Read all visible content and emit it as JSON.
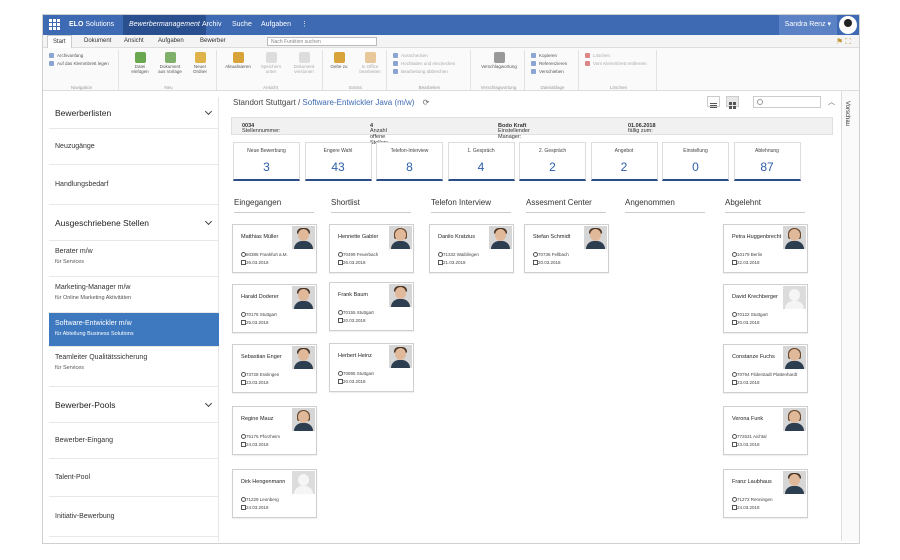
{
  "topbar": {
    "brand": "ELO",
    "brand_suffix": "Solutions",
    "tabs": [
      "Bewerbermanagement",
      "Archiv",
      "Suche",
      "Aufgaben",
      "⋮"
    ],
    "user": "Sandra Renz ▾"
  },
  "ribbon_tabs": [
    "Start",
    "Dokument",
    "Ansicht",
    "Aufgaben",
    "Bewerber"
  ],
  "ribbon_search_placeholder": "Nach Funktion suchen",
  "ribbon": {
    "navigation": {
      "items": [
        "Archivanfang",
        "Auf das Klemmbrett legen"
      ],
      "name": "Navigation"
    },
    "neu": {
      "buttons": [
        "Datei einfügen",
        "Dokument aus Vorlage",
        "Neuer Ordner"
      ],
      "name": "Neu"
    },
    "ansicht": {
      "buttons": [
        "Aktualisieren",
        "Speichern unter",
        "Dokument versionen"
      ],
      "name": "Ansicht"
    },
    "extras": {
      "buttons": [
        "Gehe zu",
        "In Office bearbeiten"
      ],
      "name": "Extras"
    },
    "bearbeiten": {
      "items": [
        "Ausschecken",
        "Hochladen und einchecken",
        "Bearbeitung abbrechen"
      ],
      "name": "Bearbeiten"
    },
    "verschlagwortung": {
      "button": "Verschlagwortung",
      "name": "Verschlagwortung"
    },
    "dateiablage": {
      "items": [
        "Kopieren",
        "Referenzieren",
        "Verschieben"
      ],
      "name": "Dateiablage"
    },
    "loeschen": {
      "items": [
        "Löschen",
        "Vom Klemmbrett entfernen"
      ],
      "name": "Löschen"
    }
  },
  "sidebar": [
    {
      "label": "Bewerberlisten",
      "head": true,
      "chev": true
    },
    {
      "label": "Neuzugänge"
    },
    {
      "label": "Handlungsbedarf"
    },
    {
      "label": "Ausgeschriebene Stellen",
      "head": true,
      "chev": true
    },
    {
      "label": "Berater m/w",
      "sub": "für Services"
    },
    {
      "label": "Marketing-Manager m/w",
      "sub": "für Online Marketing Aktivitäten"
    },
    {
      "label": "Software-Entwickler m/w",
      "sub": "für Abteilung Business Solutions",
      "active": true
    },
    {
      "label": "Teamleiter Qualitätssicherung",
      "sub": "für Services"
    },
    {
      "label": "Bewerber-Pools",
      "head": true,
      "chev": true
    },
    {
      "label": "Bewerber-Eingang"
    },
    {
      "label": "Talent-Pool"
    },
    {
      "label": "Initiativ-Bewerbung"
    }
  ],
  "breadcrumb": {
    "location": "Standort Stuttgart",
    "sep": "/",
    "job": "Software-Entwickler Java (m/w)",
    "refresh": "⟳"
  },
  "info": {
    "stellennummer_label": "Stellennummer:",
    "stellennummer": "0034",
    "offene_label": "Anzahl offene Stellen:",
    "offene": "4",
    "manager_label": "Einstellender Manager:",
    "manager": "Bodo Kraft",
    "faellig_label": "fällig zum:",
    "faellig": "01.06.2018"
  },
  "stats": [
    {
      "label": "Neue Bewerbung",
      "value": "3"
    },
    {
      "label": "Engere Wahl",
      "value": "43"
    },
    {
      "label": "Telefon-Interview",
      "value": "8"
    },
    {
      "label": "1. Gespräch",
      "value": "4"
    },
    {
      "label": "2. Gespräch",
      "value": "2"
    },
    {
      "label": "Angebot",
      "value": "2"
    },
    {
      "label": "Einstellung",
      "value": "0"
    },
    {
      "label": "Ablehnung",
      "value": "87"
    }
  ],
  "columns": [
    {
      "title": "Eingegangen",
      "cards": [
        {
          "name": "Matthias Müller",
          "loc": "60386 Frankfurt a.M.",
          "date": "26.03.2018",
          "photo": "m"
        },
        {
          "name": "Harald Doderer",
          "loc": "70178 Stuttgart",
          "date": "25.03.2018",
          "photo": "m"
        },
        {
          "name": "Sebastian Enger",
          "loc": "73728 Esslingen",
          "date": "23.03.2018",
          "photo": "m"
        },
        {
          "name": "Regine Mauz",
          "loc": "75175 Pforzheim",
          "date": "24.03.2018",
          "photo": "f"
        },
        {
          "name": "Dirk Hengenmann",
          "loc": "71229 Leonberg",
          "date": "24.03.2018",
          "photo": "gray"
        }
      ]
    },
    {
      "title": "Shortlist",
      "cards": [
        {
          "name": "Henriette Gabler",
          "loc": "70499 Feuerbach",
          "date": "26.03.2018",
          "photo": "f"
        },
        {
          "name": "Frank Baum",
          "loc": "70155 Stuttgart",
          "date": "20.03.2018",
          "photo": "m"
        },
        {
          "name": "Herbert Heinz",
          "loc": "70895 Stuttgart",
          "date": "20.03.2018",
          "photo": "m"
        }
      ]
    },
    {
      "title": "Telefon Interview",
      "cards": [
        {
          "name": "Danilo Kratzius",
          "loc": "71332 Waiblingen",
          "date": "21.03.2018",
          "photo": "m"
        }
      ]
    },
    {
      "title": "Assesment Center",
      "cards": [
        {
          "name": "Stefan Schmidt",
          "loc": "70736 Fellbach",
          "date": "20.03.2018",
          "photo": "m"
        }
      ]
    },
    {
      "title": "Angenommen",
      "cards": []
    },
    {
      "title": "Abgelehnt",
      "cards": [
        {
          "name": "Petra Huggenbrecht",
          "loc": "10179 Berlin",
          "date": "22.03.2018",
          "photo": "f"
        },
        {
          "name": "David Krechberger",
          "loc": "70122 Stuttgart",
          "date": "20.03.2018",
          "photo": "gray"
        },
        {
          "name": "Constanze Fuchs",
          "loc": "70794 Filderstadt Plattenhardt",
          "date": "23.03.2018",
          "photo": "f"
        },
        {
          "name": "Verona Funk",
          "loc": "772631 Aichtal",
          "date": "23.03.2018",
          "photo": "f"
        },
        {
          "name": "Franz Laubhaus",
          "loc": "71272 Renningen",
          "date": "24.03.2018",
          "photo": "m"
        }
      ]
    }
  ],
  "right_panel": "Vorschau",
  "colors": {
    "brand_blue": "#3e6ab3",
    "active_sidebar": "#3e79c0",
    "stat_number": "#2c5ea8"
  }
}
